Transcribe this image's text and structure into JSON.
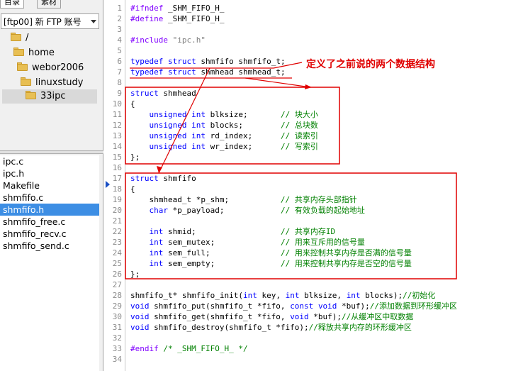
{
  "left_panel": {
    "tabs": [
      {
        "label": "目录"
      },
      {
        "label": "素材"
      }
    ],
    "account": {
      "label": "[ftp00] 新 FTP 账号"
    },
    "tree": [
      {
        "label": "/"
      },
      {
        "label": "home"
      },
      {
        "label": "webor2006"
      },
      {
        "label": "linuxstudy"
      },
      {
        "label": "33ipc",
        "selected": true
      }
    ],
    "files": [
      {
        "label": "ipc.c"
      },
      {
        "label": "ipc.h"
      },
      {
        "label": "Makefile"
      },
      {
        "label": "shmfifo.c"
      },
      {
        "label": "shmfifo.h",
        "selected": true
      },
      {
        "label": "shmfifo_free.c"
      },
      {
        "label": "shmfifo_recv.c"
      },
      {
        "label": "shmfifo_send.c"
      }
    ]
  },
  "editor": {
    "line_numbers": [
      "1",
      "2",
      "3",
      "4",
      "5",
      "6",
      "7",
      "8",
      "9",
      "10",
      "11",
      "12",
      "13",
      "14",
      "15",
      "16",
      "17",
      "18",
      "19",
      "20",
      "21",
      "22",
      "23",
      "24",
      "25",
      "26",
      "27",
      "28",
      "29",
      "30",
      "31",
      "32",
      "33",
      "34"
    ],
    "lines": [
      [
        {
          "t": "#ifndef",
          "c": "pp"
        },
        {
          "t": " _SHM_FIFO_H_",
          "c": "n"
        }
      ],
      [
        {
          "t": "#define",
          "c": "pp"
        },
        {
          "t": " _SHM_FIFO_H_",
          "c": "n"
        }
      ],
      [],
      [
        {
          "t": "#include",
          "c": "pp"
        },
        {
          "t": " ",
          "c": "n"
        },
        {
          "t": "\"ipc.h\"",
          "c": "str"
        }
      ],
      [],
      [
        {
          "t": "typedef",
          "c": "kw"
        },
        {
          "t": " ",
          "c": "n"
        },
        {
          "t": "struct",
          "c": "kw"
        },
        {
          "t": " shmfifo shmfifo_t;",
          "c": "n"
        }
      ],
      [
        {
          "t": "typedef",
          "c": "kw"
        },
        {
          "t": " ",
          "c": "n"
        },
        {
          "t": "struct",
          "c": "kw"
        },
        {
          "t": " shmhead shmhead_t;",
          "c": "n"
        }
      ],
      [],
      [
        {
          "t": "struct",
          "c": "kw"
        },
        {
          "t": " shmhead",
          "c": "n"
        }
      ],
      [
        {
          "t": "{",
          "c": "n"
        }
      ],
      [
        {
          "t": "    ",
          "c": "n"
        },
        {
          "t": "unsigned",
          "c": "kw"
        },
        {
          "t": " ",
          "c": "n"
        },
        {
          "t": "int",
          "c": "kw"
        },
        {
          "t": " blksize;       ",
          "c": "n"
        },
        {
          "t": "// 块大小",
          "c": "cmt"
        }
      ],
      [
        {
          "t": "    ",
          "c": "n"
        },
        {
          "t": "unsigned",
          "c": "kw"
        },
        {
          "t": " ",
          "c": "n"
        },
        {
          "t": "int",
          "c": "kw"
        },
        {
          "t": " blocks;        ",
          "c": "n"
        },
        {
          "t": "// 总块数",
          "c": "cmt"
        }
      ],
      [
        {
          "t": "    ",
          "c": "n"
        },
        {
          "t": "unsigned",
          "c": "kw"
        },
        {
          "t": " ",
          "c": "n"
        },
        {
          "t": "int",
          "c": "kw"
        },
        {
          "t": " rd_index;      ",
          "c": "n"
        },
        {
          "t": "// 读索引",
          "c": "cmt"
        }
      ],
      [
        {
          "t": "    ",
          "c": "n"
        },
        {
          "t": "unsigned",
          "c": "kw"
        },
        {
          "t": " ",
          "c": "n"
        },
        {
          "t": "int",
          "c": "kw"
        },
        {
          "t": " wr_index;      ",
          "c": "n"
        },
        {
          "t": "// 写索引",
          "c": "cmt"
        }
      ],
      [
        {
          "t": "};",
          "c": "n"
        }
      ],
      [],
      [
        {
          "t": "struct",
          "c": "kw"
        },
        {
          "t": " shmfifo",
          "c": "n"
        }
      ],
      [
        {
          "t": "{",
          "c": "n"
        }
      ],
      [
        {
          "t": "    shmhead_t *p_shm;           ",
          "c": "n"
        },
        {
          "t": "// 共享内存头部指针",
          "c": "cmt"
        }
      ],
      [
        {
          "t": "    ",
          "c": "n"
        },
        {
          "t": "char",
          "c": "kw"
        },
        {
          "t": " *p_payload;            ",
          "c": "n"
        },
        {
          "t": "// 有效负载的起始地址",
          "c": "cmt"
        }
      ],
      [],
      [
        {
          "t": "    ",
          "c": "n"
        },
        {
          "t": "int",
          "c": "kw"
        },
        {
          "t": " shmid;                  ",
          "c": "n"
        },
        {
          "t": "// 共享内存ID",
          "c": "cmt"
        }
      ],
      [
        {
          "t": "    ",
          "c": "n"
        },
        {
          "t": "int",
          "c": "kw"
        },
        {
          "t": " sem_mutex;              ",
          "c": "n"
        },
        {
          "t": "// 用来互斥用的信号量",
          "c": "cmt"
        }
      ],
      [
        {
          "t": "    ",
          "c": "n"
        },
        {
          "t": "int",
          "c": "kw"
        },
        {
          "t": " sem_full;               ",
          "c": "n"
        },
        {
          "t": "// 用来控制共享内存是否满的信号量",
          "c": "cmt"
        }
      ],
      [
        {
          "t": "    ",
          "c": "n"
        },
        {
          "t": "int",
          "c": "kw"
        },
        {
          "t": " sem_empty;              ",
          "c": "n"
        },
        {
          "t": "// 用来控制共享内存是否空的信号量",
          "c": "cmt"
        }
      ],
      [
        {
          "t": "};",
          "c": "n"
        }
      ],
      [],
      [
        {
          "t": "shmfifo_t* shmfifo_init(",
          "c": "n"
        },
        {
          "t": "int",
          "c": "kw"
        },
        {
          "t": " key, ",
          "c": "n"
        },
        {
          "t": "int",
          "c": "kw"
        },
        {
          "t": " blksize, ",
          "c": "n"
        },
        {
          "t": "int",
          "c": "kw"
        },
        {
          "t": " blocks);",
          "c": "n"
        },
        {
          "t": "//初始化",
          "c": "cmt"
        }
      ],
      [
        {
          "t": "void",
          "c": "kw"
        },
        {
          "t": " shmfifo_put(shmfifo_t *fifo, ",
          "c": "n"
        },
        {
          "t": "const",
          "c": "kw"
        },
        {
          "t": " ",
          "c": "n"
        },
        {
          "t": "void",
          "c": "kw"
        },
        {
          "t": " *buf);",
          "c": "n"
        },
        {
          "t": "//添加数据到环形缓冲区",
          "c": "cmt"
        }
      ],
      [
        {
          "t": "void",
          "c": "kw"
        },
        {
          "t": " shmfifo_get(shmfifo_t *fifo, ",
          "c": "n"
        },
        {
          "t": "void",
          "c": "kw"
        },
        {
          "t": " *buf);",
          "c": "n"
        },
        {
          "t": "//从缓冲区中取数据",
          "c": "cmt"
        }
      ],
      [
        {
          "t": "void",
          "c": "kw"
        },
        {
          "t": " shmfifo_destroy(shmfifo_t *fifo);",
          "c": "n"
        },
        {
          "t": "//释放共享内存的环形缓冲区",
          "c": "cmt"
        }
      ],
      [],
      [
        {
          "t": "#endif",
          "c": "pp"
        },
        {
          "t": " /* _SHM_FIFO_H_ */",
          "c": "cmt"
        }
      ],
      []
    ]
  },
  "annotation": {
    "text": "定义了之前说的两个数据结构"
  },
  "colors": {
    "highlight_red": "#e00000",
    "selection_blue": "#3d8ee4",
    "keyword": "#0000ff",
    "preprocessor": "#8000ff",
    "comment": "#008000"
  }
}
